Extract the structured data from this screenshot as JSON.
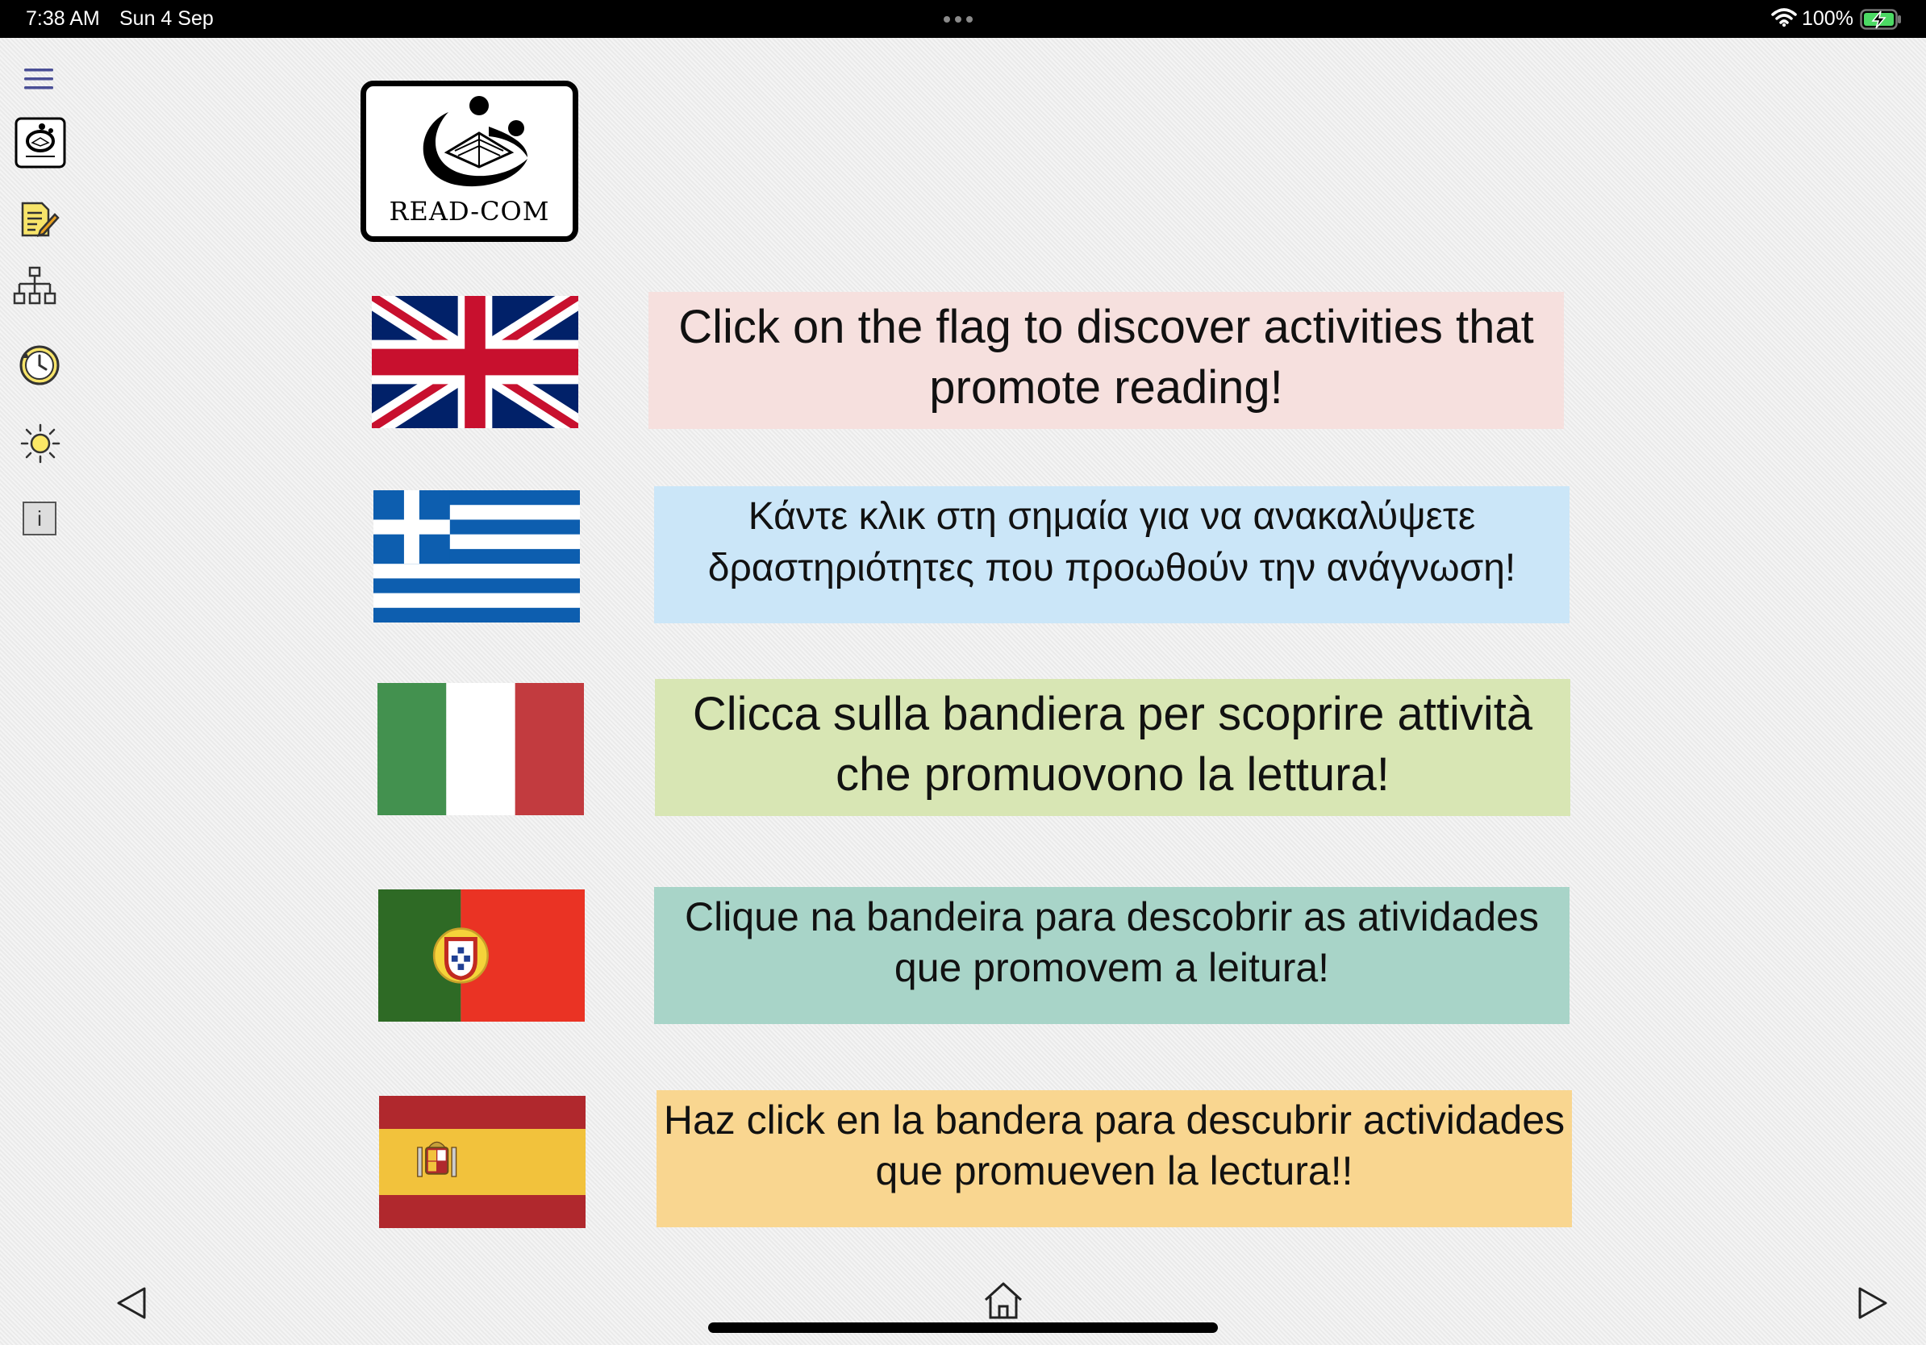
{
  "status": {
    "time": "7:38 AM",
    "date": "Sun 4 Sep",
    "battery": "100%"
  },
  "sidebar": {
    "icons": [
      "menu-icon",
      "read-com-logo-icon",
      "notes-icon",
      "sitemap-icon",
      "clock-icon",
      "brightness-icon",
      "info-icon"
    ],
    "info_glyph": "i"
  },
  "logo": {
    "text": "READ-COM"
  },
  "languages": [
    {
      "flag": "uk-flag",
      "message": "Click on the flag to discover activities that promote reading!",
      "color": "#f6e0de"
    },
    {
      "flag": "greek-flag",
      "message": "Κάντε κλικ στη σημαία για να ανακαλύψετε δραστηριότητες που προωθούν την ανάγνωση!",
      "color": "#cbe6f8"
    },
    {
      "flag": "italian-flag",
      "message": "Clicca sulla bandiera per scoprire attività che promuovono la lettura!",
      "color": "#d8e6b4"
    },
    {
      "flag": "portuguese-flag",
      "message": "Clique na bandeira para descobrir as atividades que promovem a leitura!",
      "color": "#a8d4c8"
    },
    {
      "flag": "spanish-flag",
      "message": "Haz click en la bandera para descubrir actividades que promueven la lectura!!",
      "color": "#f9d690"
    }
  ],
  "nav": {
    "icons": [
      "back-arrow-icon",
      "home-icon",
      "forward-arrow-icon"
    ]
  }
}
